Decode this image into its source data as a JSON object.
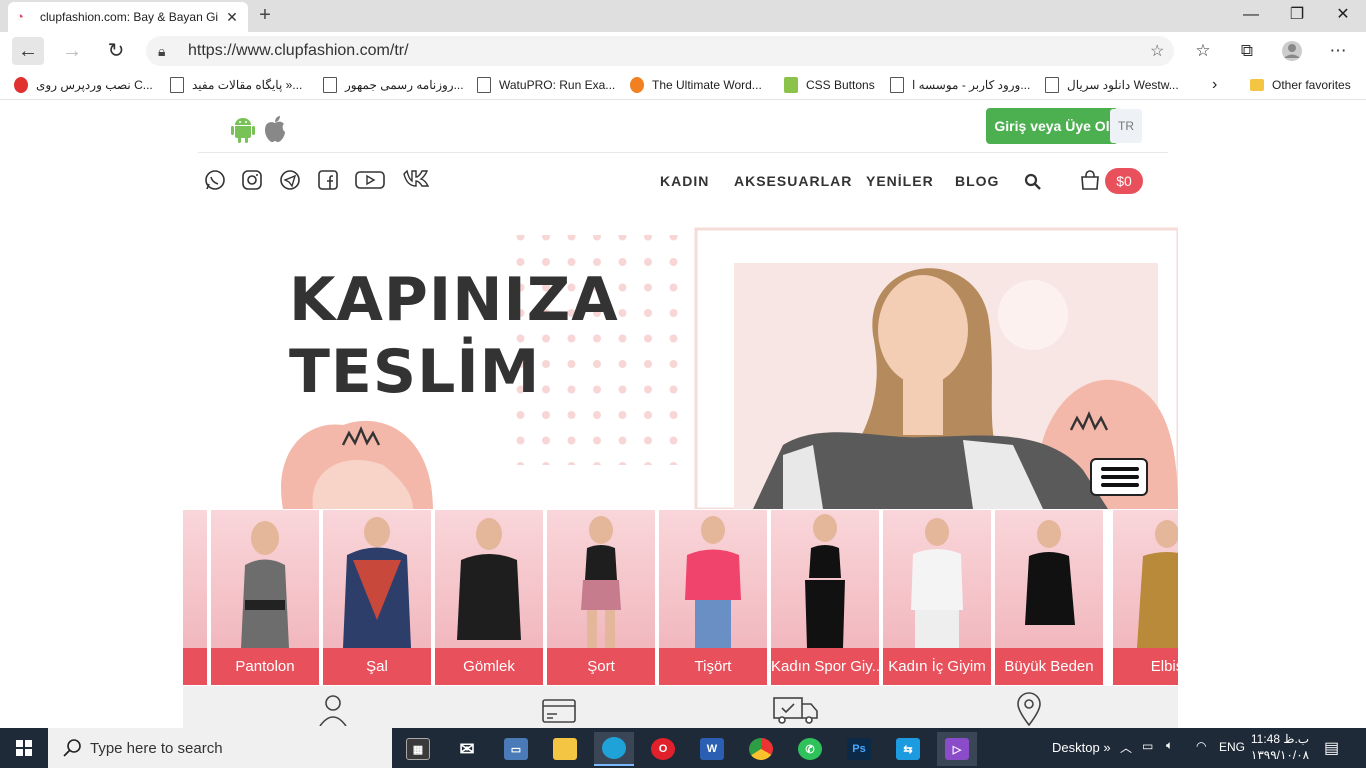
{
  "browser": {
    "tab_title": "clupfashion.com: Bay & Bayan Gi",
    "url": "https://www.clupfashion.com/tr/",
    "bookmarks": [
      {
        "label": "نصب وردپرس روی C...",
        "icon": "red"
      },
      {
        "label": "پایگاه مقالات مفید »...",
        "icon": "page"
      },
      {
        "label": "روزنامه رسمی جمهور...",
        "icon": "page"
      },
      {
        "label": "WatuPRO: Run Exa...",
        "icon": "page"
      },
      {
        "label": "The Ultimate Word...",
        "icon": "orange"
      },
      {
        "label": "CSS Buttons",
        "icon": "green"
      },
      {
        "label": "ورود کاربر - موسسه ا...",
        "icon": "page"
      },
      {
        "label": "دانلود سریال Westw...",
        "icon": "page"
      }
    ],
    "other_favorites": "Other favorites"
  },
  "site": {
    "login_label": "Giriş veya Üye Ol",
    "lang": "TR",
    "nav": [
      "KADIN",
      "AKSESUARLAR",
      "YENİLER",
      "BLOG"
    ],
    "cart_total": "$0",
    "hero_line1": "KAPINIZA",
    "hero_line2": "TESLİM",
    "categories": [
      "",
      "Pantolon",
      "Şal",
      "Gömlek",
      "Şort",
      "Tişört",
      "Kadın Spor Giy...",
      "Kadın İç Giyim",
      "Büyük Beden",
      "Elbis"
    ]
  },
  "taskbar": {
    "search_placeholder": "Type here to search",
    "desktop_label": "Desktop",
    "lang": "ENG",
    "time": "11:48 ب.ظ",
    "date": "۱۳۹۹/۱۰/۰۸"
  },
  "colors": {
    "brand_red": "#e8505b",
    "login_green": "#4caf50",
    "taskbar": "#1f2a38"
  }
}
